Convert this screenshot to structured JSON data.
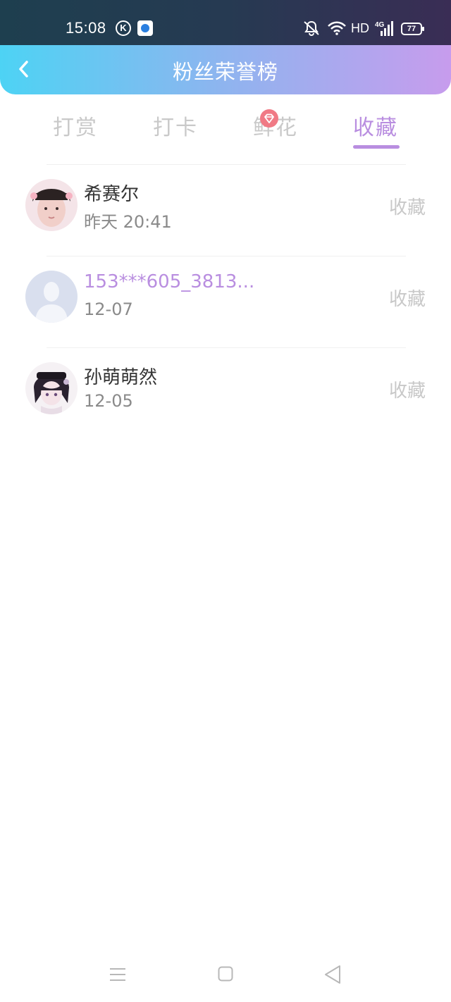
{
  "status_bar": {
    "time": "15:08",
    "k_icon_letter": "K",
    "network": "HD",
    "signal_label": "4G",
    "battery": "77"
  },
  "header": {
    "title": "粉丝荣誉榜",
    "back_icon": "chevron-left-icon"
  },
  "tabs": [
    {
      "label": "打赏",
      "active": false
    },
    {
      "label": "打卡",
      "active": false
    },
    {
      "label": "鲜花",
      "active": false
    },
    {
      "label": "收藏",
      "active": true
    }
  ],
  "fans": [
    {
      "name": "希赛尔",
      "date": "昨天 20:41",
      "action": "收藏",
      "vip": false
    },
    {
      "name": "153***605_3813...",
      "date": "12-07",
      "action": "收藏",
      "vip": true
    },
    {
      "name": "孙萌萌然",
      "date": "12-05",
      "action": "收藏",
      "vip": false
    }
  ],
  "colors": {
    "accent": "#b98ee0",
    "header_start": "#4dd3f4",
    "header_end": "#c79ced"
  }
}
